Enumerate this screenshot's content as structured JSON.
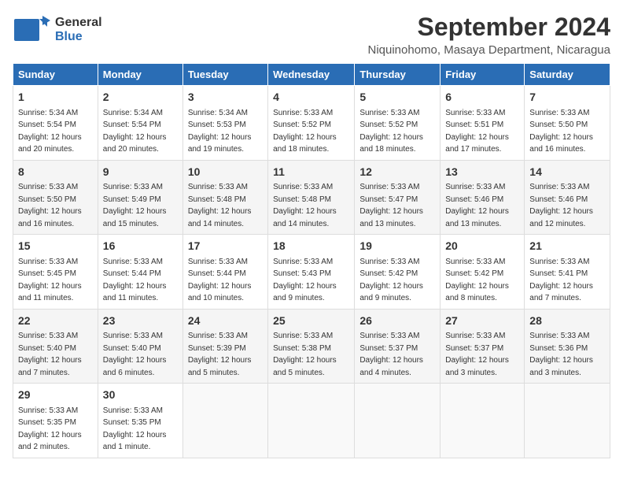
{
  "logo": {
    "general": "General",
    "blue": "Blue"
  },
  "header": {
    "month": "September 2024",
    "location": "Niquinohomo, Masaya Department, Nicaragua"
  },
  "weekdays": [
    "Sunday",
    "Monday",
    "Tuesday",
    "Wednesday",
    "Thursday",
    "Friday",
    "Saturday"
  ],
  "rows": [
    [
      {
        "day": "1",
        "sunrise": "Sunrise: 5:34 AM",
        "sunset": "Sunset: 5:54 PM",
        "daylight": "Daylight: 12 hours and 20 minutes."
      },
      {
        "day": "2",
        "sunrise": "Sunrise: 5:34 AM",
        "sunset": "Sunset: 5:54 PM",
        "daylight": "Daylight: 12 hours and 20 minutes."
      },
      {
        "day": "3",
        "sunrise": "Sunrise: 5:34 AM",
        "sunset": "Sunset: 5:53 PM",
        "daylight": "Daylight: 12 hours and 19 minutes."
      },
      {
        "day": "4",
        "sunrise": "Sunrise: 5:33 AM",
        "sunset": "Sunset: 5:52 PM",
        "daylight": "Daylight: 12 hours and 18 minutes."
      },
      {
        "day": "5",
        "sunrise": "Sunrise: 5:33 AM",
        "sunset": "Sunset: 5:52 PM",
        "daylight": "Daylight: 12 hours and 18 minutes."
      },
      {
        "day": "6",
        "sunrise": "Sunrise: 5:33 AM",
        "sunset": "Sunset: 5:51 PM",
        "daylight": "Daylight: 12 hours and 17 minutes."
      },
      {
        "day": "7",
        "sunrise": "Sunrise: 5:33 AM",
        "sunset": "Sunset: 5:50 PM",
        "daylight": "Daylight: 12 hours and 16 minutes."
      }
    ],
    [
      {
        "day": "8",
        "sunrise": "Sunrise: 5:33 AM",
        "sunset": "Sunset: 5:50 PM",
        "daylight": "Daylight: 12 hours and 16 minutes."
      },
      {
        "day": "9",
        "sunrise": "Sunrise: 5:33 AM",
        "sunset": "Sunset: 5:49 PM",
        "daylight": "Daylight: 12 hours and 15 minutes."
      },
      {
        "day": "10",
        "sunrise": "Sunrise: 5:33 AM",
        "sunset": "Sunset: 5:48 PM",
        "daylight": "Daylight: 12 hours and 14 minutes."
      },
      {
        "day": "11",
        "sunrise": "Sunrise: 5:33 AM",
        "sunset": "Sunset: 5:48 PM",
        "daylight": "Daylight: 12 hours and 14 minutes."
      },
      {
        "day": "12",
        "sunrise": "Sunrise: 5:33 AM",
        "sunset": "Sunset: 5:47 PM",
        "daylight": "Daylight: 12 hours and 13 minutes."
      },
      {
        "day": "13",
        "sunrise": "Sunrise: 5:33 AM",
        "sunset": "Sunset: 5:46 PM",
        "daylight": "Daylight: 12 hours and 13 minutes."
      },
      {
        "day": "14",
        "sunrise": "Sunrise: 5:33 AM",
        "sunset": "Sunset: 5:46 PM",
        "daylight": "Daylight: 12 hours and 12 minutes."
      }
    ],
    [
      {
        "day": "15",
        "sunrise": "Sunrise: 5:33 AM",
        "sunset": "Sunset: 5:45 PM",
        "daylight": "Daylight: 12 hours and 11 minutes."
      },
      {
        "day": "16",
        "sunrise": "Sunrise: 5:33 AM",
        "sunset": "Sunset: 5:44 PM",
        "daylight": "Daylight: 12 hours and 11 minutes."
      },
      {
        "day": "17",
        "sunrise": "Sunrise: 5:33 AM",
        "sunset": "Sunset: 5:44 PM",
        "daylight": "Daylight: 12 hours and 10 minutes."
      },
      {
        "day": "18",
        "sunrise": "Sunrise: 5:33 AM",
        "sunset": "Sunset: 5:43 PM",
        "daylight": "Daylight: 12 hours and 9 minutes."
      },
      {
        "day": "19",
        "sunrise": "Sunrise: 5:33 AM",
        "sunset": "Sunset: 5:42 PM",
        "daylight": "Daylight: 12 hours and 9 minutes."
      },
      {
        "day": "20",
        "sunrise": "Sunrise: 5:33 AM",
        "sunset": "Sunset: 5:42 PM",
        "daylight": "Daylight: 12 hours and 8 minutes."
      },
      {
        "day": "21",
        "sunrise": "Sunrise: 5:33 AM",
        "sunset": "Sunset: 5:41 PM",
        "daylight": "Daylight: 12 hours and 7 minutes."
      }
    ],
    [
      {
        "day": "22",
        "sunrise": "Sunrise: 5:33 AM",
        "sunset": "Sunset: 5:40 PM",
        "daylight": "Daylight: 12 hours and 7 minutes."
      },
      {
        "day": "23",
        "sunrise": "Sunrise: 5:33 AM",
        "sunset": "Sunset: 5:40 PM",
        "daylight": "Daylight: 12 hours and 6 minutes."
      },
      {
        "day": "24",
        "sunrise": "Sunrise: 5:33 AM",
        "sunset": "Sunset: 5:39 PM",
        "daylight": "Daylight: 12 hours and 5 minutes."
      },
      {
        "day": "25",
        "sunrise": "Sunrise: 5:33 AM",
        "sunset": "Sunset: 5:38 PM",
        "daylight": "Daylight: 12 hours and 5 minutes."
      },
      {
        "day": "26",
        "sunrise": "Sunrise: 5:33 AM",
        "sunset": "Sunset: 5:37 PM",
        "daylight": "Daylight: 12 hours and 4 minutes."
      },
      {
        "day": "27",
        "sunrise": "Sunrise: 5:33 AM",
        "sunset": "Sunset: 5:37 PM",
        "daylight": "Daylight: 12 hours and 3 minutes."
      },
      {
        "day": "28",
        "sunrise": "Sunrise: 5:33 AM",
        "sunset": "Sunset: 5:36 PM",
        "daylight": "Daylight: 12 hours and 3 minutes."
      }
    ],
    [
      {
        "day": "29",
        "sunrise": "Sunrise: 5:33 AM",
        "sunset": "Sunset: 5:35 PM",
        "daylight": "Daylight: 12 hours and 2 minutes."
      },
      {
        "day": "30",
        "sunrise": "Sunrise: 5:33 AM",
        "sunset": "Sunset: 5:35 PM",
        "daylight": "Daylight: 12 hours and 1 minute."
      },
      null,
      null,
      null,
      null,
      null
    ]
  ]
}
